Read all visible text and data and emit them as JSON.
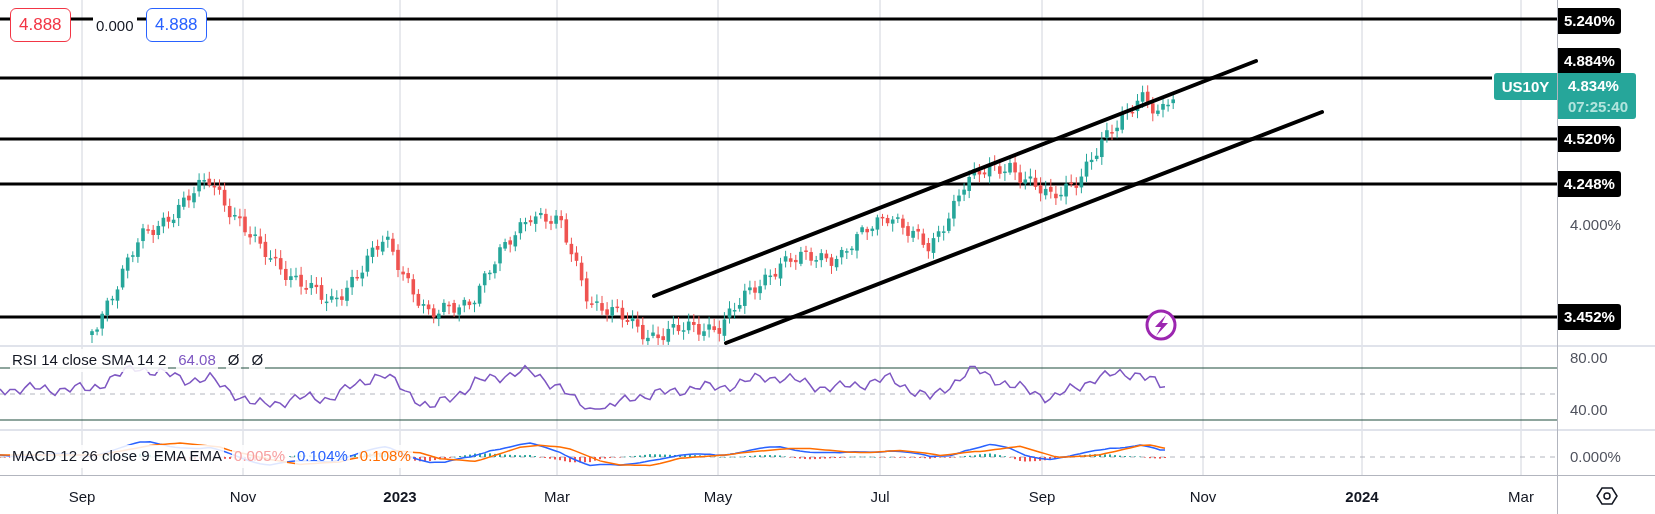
{
  "trade_legend": {
    "sell_price": "4.888",
    "spread": "0.000",
    "buy_price": "4.888"
  },
  "price_levels": [
    {
      "label": "5.240%"
    },
    {
      "label": "4.884%"
    },
    {
      "label": "4.520%"
    },
    {
      "label": "4.248%"
    },
    {
      "label": "3.452%"
    }
  ],
  "price_axis": {
    "ticks": [
      "4.000%"
    ]
  },
  "symbol": {
    "name": "US10Y",
    "price": "4.834%",
    "countdown": "07:25:40"
  },
  "rsi": {
    "legend": "RSI 14 close SMA 14 2",
    "value": "64.08",
    "extras": [
      "Ø",
      "Ø"
    ],
    "axis": [
      "80.00",
      "40.00"
    ]
  },
  "macd": {
    "legend": "MACD 12 26 close 9 EMA EMA",
    "values": [
      {
        "text": "0.005%",
        "color": "#f7a1a1"
      },
      {
        "text": "0.104%",
        "color": "#2962ff"
      },
      {
        "text": "0.108%",
        "color": "#ff6d00"
      }
    ],
    "axis": [
      "0.000%"
    ]
  },
  "time_axis": [
    {
      "label": "Sep",
      "kind": "month"
    },
    {
      "label": "Nov",
      "kind": "month"
    },
    {
      "label": "2023",
      "kind": "year"
    },
    {
      "label": "Mar",
      "kind": "month"
    },
    {
      "label": "May",
      "kind": "month"
    },
    {
      "label": "Jul",
      "kind": "month"
    },
    {
      "label": "Sep",
      "kind": "month"
    },
    {
      "label": "Nov",
      "kind": "month"
    },
    {
      "label": "2024",
      "kind": "year"
    },
    {
      "label": "Mar",
      "kind": "month"
    }
  ]
}
